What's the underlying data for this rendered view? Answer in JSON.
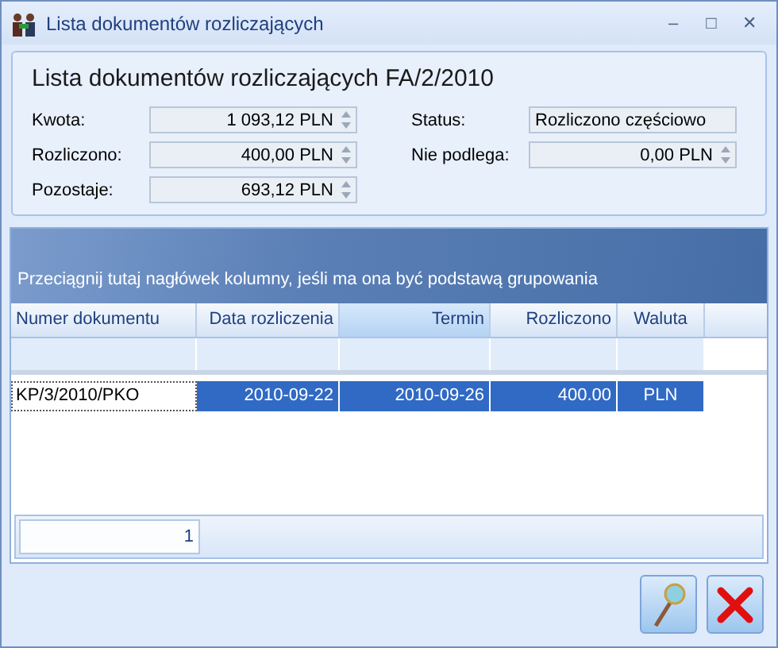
{
  "window": {
    "title": "Lista dokumentów rozliczających",
    "controls": [
      "–",
      "□",
      "✕"
    ]
  },
  "header": {
    "title": "Lista dokumentów rozliczających FA/2/2010",
    "fields_left": [
      {
        "label": "Kwota:",
        "value": "1 093,12 PLN"
      },
      {
        "label": "Rozliczono:",
        "value": "400,00 PLN"
      },
      {
        "label": "Pozostaje:",
        "value": "693,12 PLN"
      }
    ],
    "fields_right": [
      {
        "label": "Status:",
        "value": "Rozliczono częściowo",
        "kind": "text"
      },
      {
        "label": "Nie podlega:",
        "value": "0,00 PLN",
        "kind": "spin"
      }
    ]
  },
  "grid": {
    "group_hint": "Przeciągnij tutaj nagłówek kolumny, jeśli ma ona być podstawą grupowania",
    "columns": [
      {
        "label": "Numer dokumentu",
        "sorted": false
      },
      {
        "label": "Data rozliczenia",
        "sorted": false
      },
      {
        "label": "Termin",
        "sorted": true
      },
      {
        "label": "Rozliczono",
        "sorted": false
      },
      {
        "label": "Waluta",
        "sorted": false
      }
    ],
    "rows": [
      {
        "cells": [
          "KP/3/2010/PKO",
          "2010-09-22",
          "2010-09-26",
          "400.00",
          "PLN"
        ],
        "selected": true
      }
    ],
    "footer_count": "1"
  }
}
